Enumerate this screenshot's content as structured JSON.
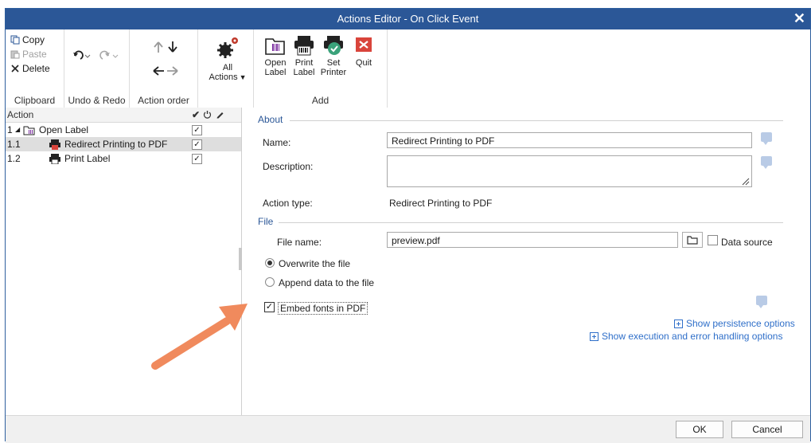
{
  "window": {
    "title": "Actions Editor - On Click Event",
    "close_glyph": "✕"
  },
  "ribbon": {
    "clipboard": {
      "copy": "Copy",
      "paste": "Paste",
      "delete": "Delete",
      "label": "Clipboard"
    },
    "undo_redo": {
      "label": "Undo & Redo"
    },
    "action_order": {
      "label": "Action order"
    },
    "all_actions": {
      "line1": "All",
      "line2": "Actions"
    },
    "add": {
      "open_label": {
        "line1": "Open",
        "line2": "Label"
      },
      "print_label": {
        "line1": "Print",
        "line2": "Label"
      },
      "set_printer": {
        "line1": "Set",
        "line2": "Printer"
      },
      "quit": "Quit",
      "label": "Add"
    }
  },
  "tree": {
    "header": "Action",
    "rows": [
      {
        "num": "1",
        "label": "Open Label",
        "checked": true
      },
      {
        "num": "1.1",
        "label": "Redirect Printing to PDF",
        "checked": true,
        "selected": true
      },
      {
        "num": "1.2",
        "label": "Print Label",
        "checked": true
      }
    ]
  },
  "about": {
    "section": "About",
    "name_label": "Name:",
    "name_value": "Redirect Printing to PDF",
    "description_label": "Description:",
    "description_value": "",
    "action_type_label": "Action type:",
    "action_type_value": "Redirect Printing to PDF"
  },
  "file": {
    "section": "File",
    "file_name_label": "File name:",
    "file_name_value": "preview.pdf",
    "data_source_label": "Data source",
    "overwrite_label": "Overwrite the file",
    "append_label": "Append data to the file",
    "embed_fonts_label": "Embed fonts in PDF",
    "embed_fonts_checked": true
  },
  "links": {
    "persistence": "Show persistence options",
    "execution": "Show execution and error handling options"
  },
  "buttons": {
    "ok": "OK",
    "cancel": "Cancel"
  },
  "colors": {
    "titlebar": "#2b5797",
    "accent": "#2f6fc9",
    "arrow": "#f08a5d",
    "quit_red": "#d9443b",
    "set_printer_green": "#3aa27a"
  }
}
